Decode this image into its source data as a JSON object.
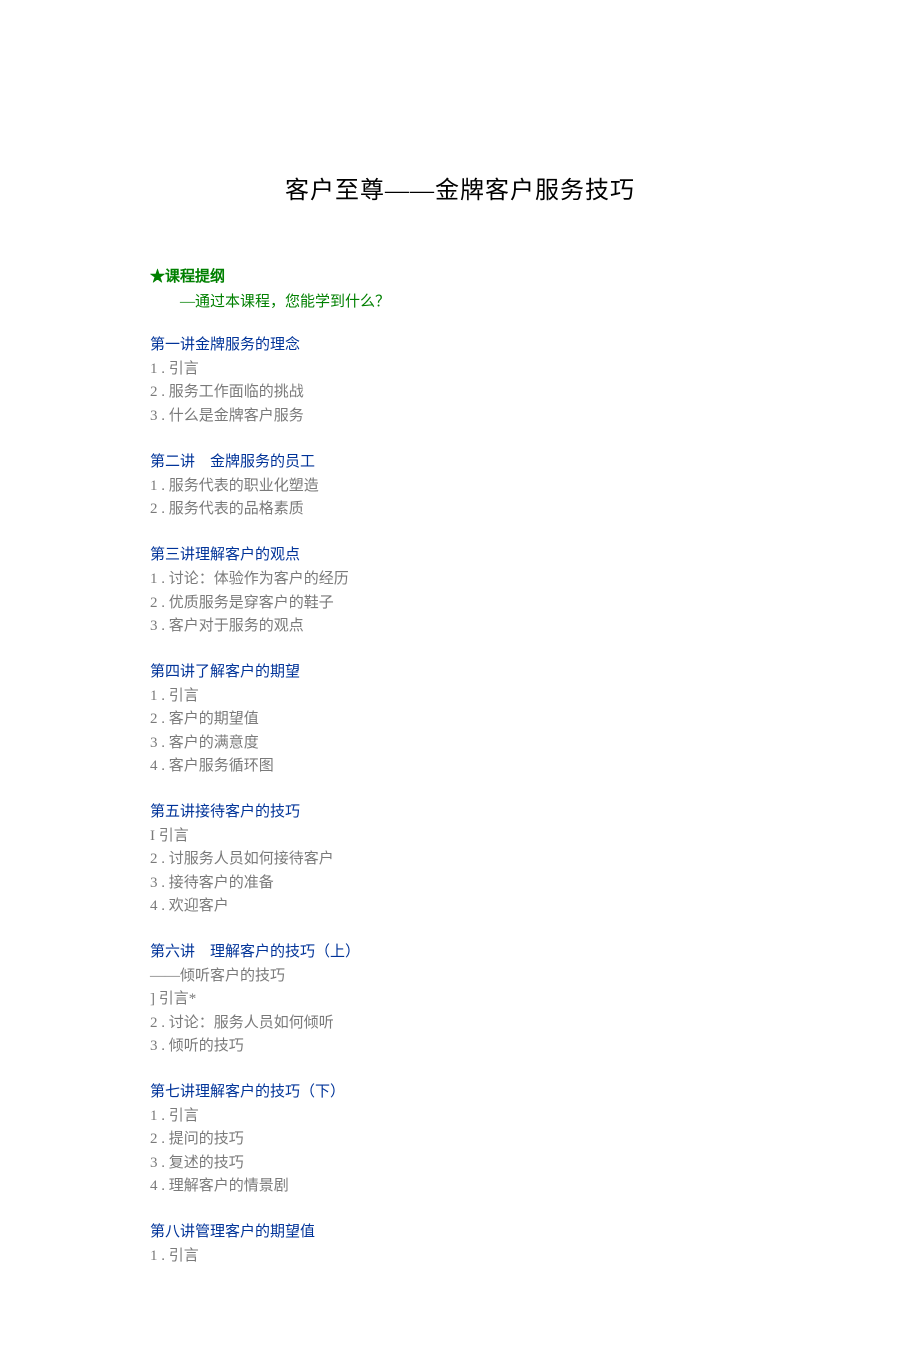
{
  "title": "客户至尊——金牌客户服务技巧",
  "outline_star": "★",
  "outline_heading": "课程提纲",
  "outline_sub": "―通过本课程，您能学到什么？",
  "sections": [
    {
      "title": "第一讲金牌服务的理念",
      "items": [
        "1 . 引言",
        "2 . 服务工作面临的挑战",
        "3 . 什么是金牌客户服务"
      ]
    },
    {
      "title": "第二讲　金牌服务的员工",
      "items": [
        "1 . 服务代表的职业化塑造",
        "2 . 服务代表的品格素质"
      ]
    },
    {
      "title": "第三讲理解客户的观点",
      "items": [
        "1 . 讨论：体验作为客户的经历",
        "2 . 优质服务是穿客户的鞋子",
        "3 . 客户对于服务的观点"
      ]
    },
    {
      "title": "第四讲了解客户的期望",
      "items": [
        "1 . 引言",
        "2 . 客户的期望值",
        "3 . 客户的满意度",
        "4 . 客户服务循环图"
      ]
    },
    {
      "title": "第五讲接待客户的技巧",
      "items": [
        "I 引言",
        "2 . 讨服务人员如何接待客户",
        "3 . 接待客户的准备",
        "4 . 欢迎客户"
      ]
    },
    {
      "title": "第六讲　理解客户的技巧（上）",
      "subtitle": "——倾听客户的技巧",
      "items": [
        "] 引言*",
        "2 . 讨论：服务人员如何倾听",
        "3 . 倾听的技巧"
      ]
    },
    {
      "title": "第七讲理解客户的技巧（下）",
      "items": [
        "1 . 引言",
        "2 . 提问的技巧",
        "3 . 复述的技巧",
        "4 . 理解客户的情景剧"
      ]
    },
    {
      "title": "第八讲管理客户的期望值",
      "items": [
        "1 . 引言"
      ]
    }
  ]
}
